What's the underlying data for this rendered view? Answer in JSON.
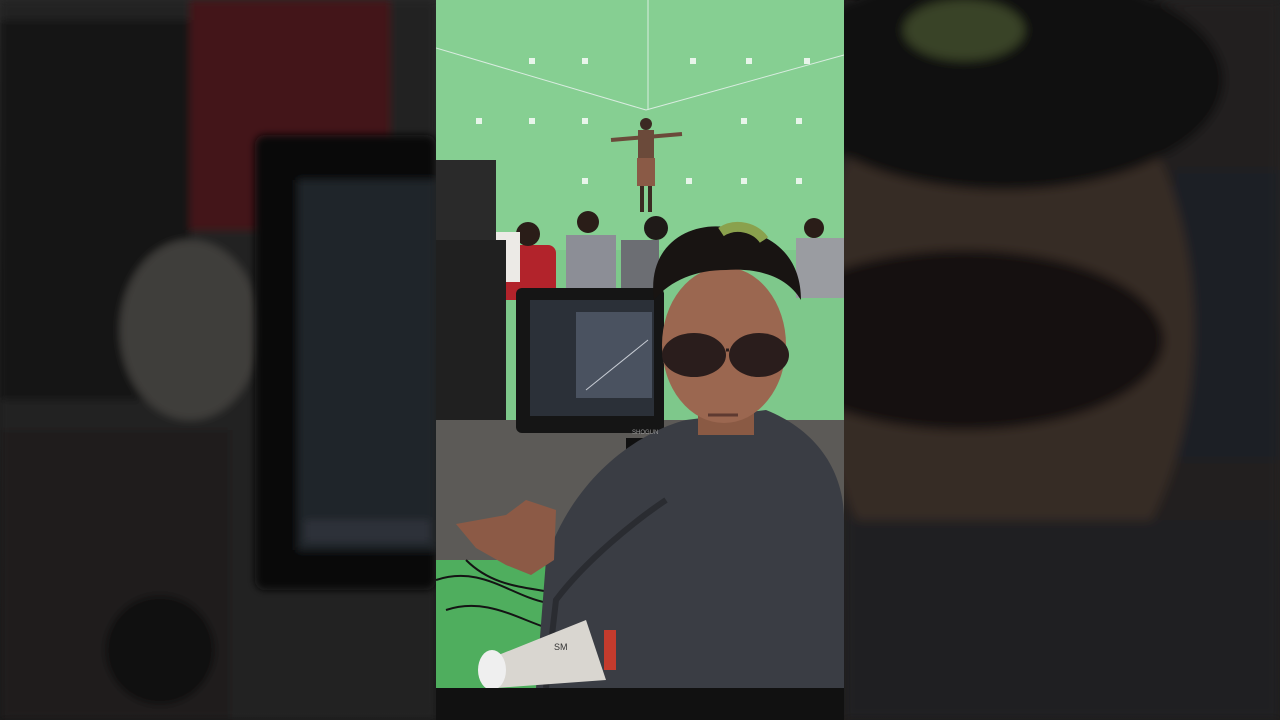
{
  "scene": {
    "subject": "selfie-at-green-screen-set",
    "colors": {
      "green_screen": "#7ec88b",
      "green_floor": "#4fae5e",
      "jacket": "#3a3d44",
      "monitor_bezel": "#151515",
      "monitor_screen": "#2b3038",
      "hair_highlight": "#8aa14d"
    },
    "monitor": {
      "brand_label": "SHOGUN"
    },
    "megaphone": {
      "label": "SM"
    }
  }
}
